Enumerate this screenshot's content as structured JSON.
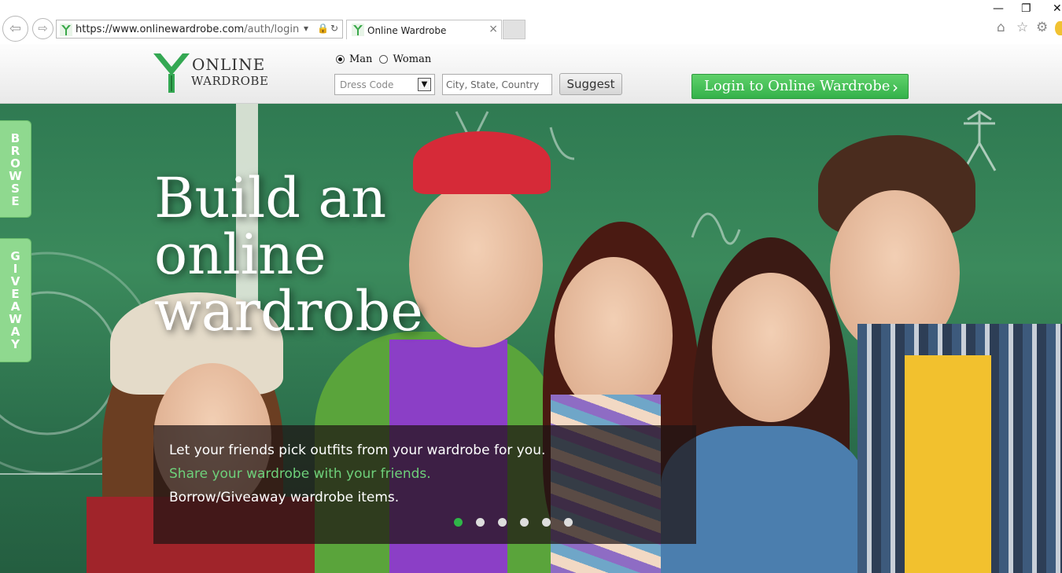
{
  "browser": {
    "url_prefix": "https://www.",
    "url_domain": "onlinewardrobe.com",
    "url_path": "/auth/login",
    "tab_title": "Online Wardrobe",
    "tab_close": "×",
    "minimize": "—",
    "restore": "❐",
    "close": "✕",
    "back": "⇦",
    "forward": "⇨",
    "home": "⌂",
    "favorites": "☆",
    "settings": "⚙"
  },
  "header": {
    "logo_line1": "ONLINE",
    "logo_line2": "WARDROBE",
    "gender_options": [
      "Man",
      "Woman"
    ],
    "gender_selected": "Man",
    "dress_code_placeholder": "Dress Code",
    "location_placeholder": "City, State, Country",
    "suggest_label": "Suggest",
    "login_label": "Login to Online Wardrobe",
    "login_chevron": "›"
  },
  "side_tabs": {
    "browse": [
      "B",
      "R",
      "O",
      "W",
      "S",
      "E"
    ],
    "giveaway": [
      "G",
      "I",
      "V",
      "E",
      "A",
      "W",
      "A",
      "Y"
    ]
  },
  "hero": {
    "headline": [
      "Build an",
      "online",
      "wardrobe"
    ],
    "caption_lines": [
      "Let your friends pick outfits from your wardrobe for you.",
      "Share your wardrobe with your friends.",
      "Borrow/Giveaway wardrobe items."
    ],
    "slide_count": 6,
    "active_slide": 1
  },
  "colors": {
    "brand_green": "#34b14a",
    "side_tab_green": "#8fd98f",
    "caption_highlight": "#6ed07a"
  }
}
